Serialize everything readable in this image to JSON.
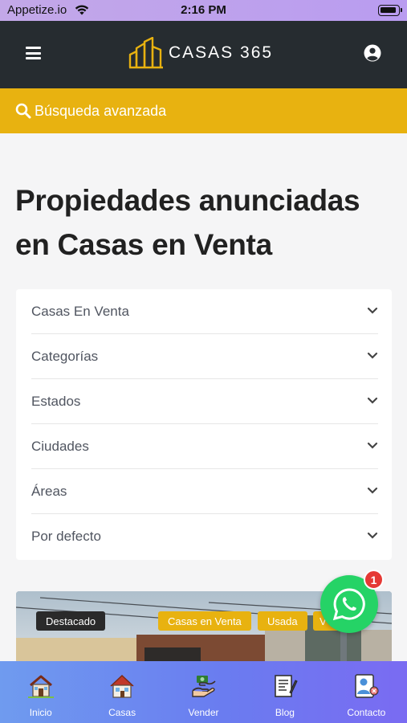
{
  "status_bar": {
    "carrier": "Appetize.io",
    "time": "2:16 PM"
  },
  "header": {
    "logo_text": "CASAS  365"
  },
  "search": {
    "label": "Búsqueda avanzada"
  },
  "page_title": "Propiedades anunciadas en Casas en Venta",
  "filters": [
    {
      "label": "Casas En Venta"
    },
    {
      "label": "Categorías"
    },
    {
      "label": "Estados"
    },
    {
      "label": "Ciudades"
    },
    {
      "label": "Áreas"
    },
    {
      "label": "Por defecto"
    }
  ],
  "listing": {
    "badges": {
      "featured": "Destacado",
      "category": "Casas en Venta",
      "condition": "Usada",
      "extra": "V"
    }
  },
  "whatsapp": {
    "notification_count": "1"
  },
  "bottom_nav": [
    {
      "label": "Inicio",
      "icon": "home-icon"
    },
    {
      "label": "Casas",
      "icon": "houses-icon"
    },
    {
      "label": "Vender",
      "icon": "sell-icon"
    },
    {
      "label": "Blog",
      "icon": "blog-icon"
    },
    {
      "label": "Contacto",
      "icon": "contact-icon"
    }
  ],
  "colors": {
    "header": "#262c30",
    "accent": "#e8b210",
    "whatsapp": "#25d366",
    "nav_start": "#6f9bef",
    "nav_end": "#7a6bf2"
  }
}
